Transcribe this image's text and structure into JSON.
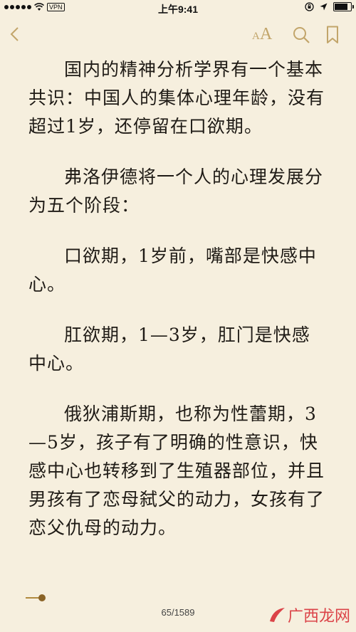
{
  "status_bar": {
    "carrier_dots": 5,
    "vpn": "VPN",
    "time": "上午9:41",
    "battery_level": 0.9
  },
  "toolbar": {
    "back_icon": "chevron-left-icon",
    "font_icon": "font-size-icon",
    "font_icon_small": "A",
    "font_icon_big": "A",
    "search_icon": "search-icon",
    "bookmark_icon": "bookmark-icon",
    "accent_color": "#c2a56a"
  },
  "content": {
    "paragraphs": [
      "国内的精神分析学界有一个基本共识：中国人的集体心理年龄，没有超过1岁，还停留在口欲期。",
      "弗洛伊德将一个人的心理发展分为五个阶段：",
      "口欲期，1岁前，嘴部是快感中心。",
      "肛欲期，1—3岁，肛门是快感中心。",
      "俄狄浦斯期，也称为性蕾期，3—5岁，孩子有了明确的性意识，快感中心也转移到了生殖器部位，并且男孩有了恋母弑父的动力，女孩有了恋父仇母的动力。"
    ]
  },
  "footer": {
    "page_indicator": "65/1589",
    "progress_fraction": 0.04,
    "watermark": "广西龙网"
  }
}
